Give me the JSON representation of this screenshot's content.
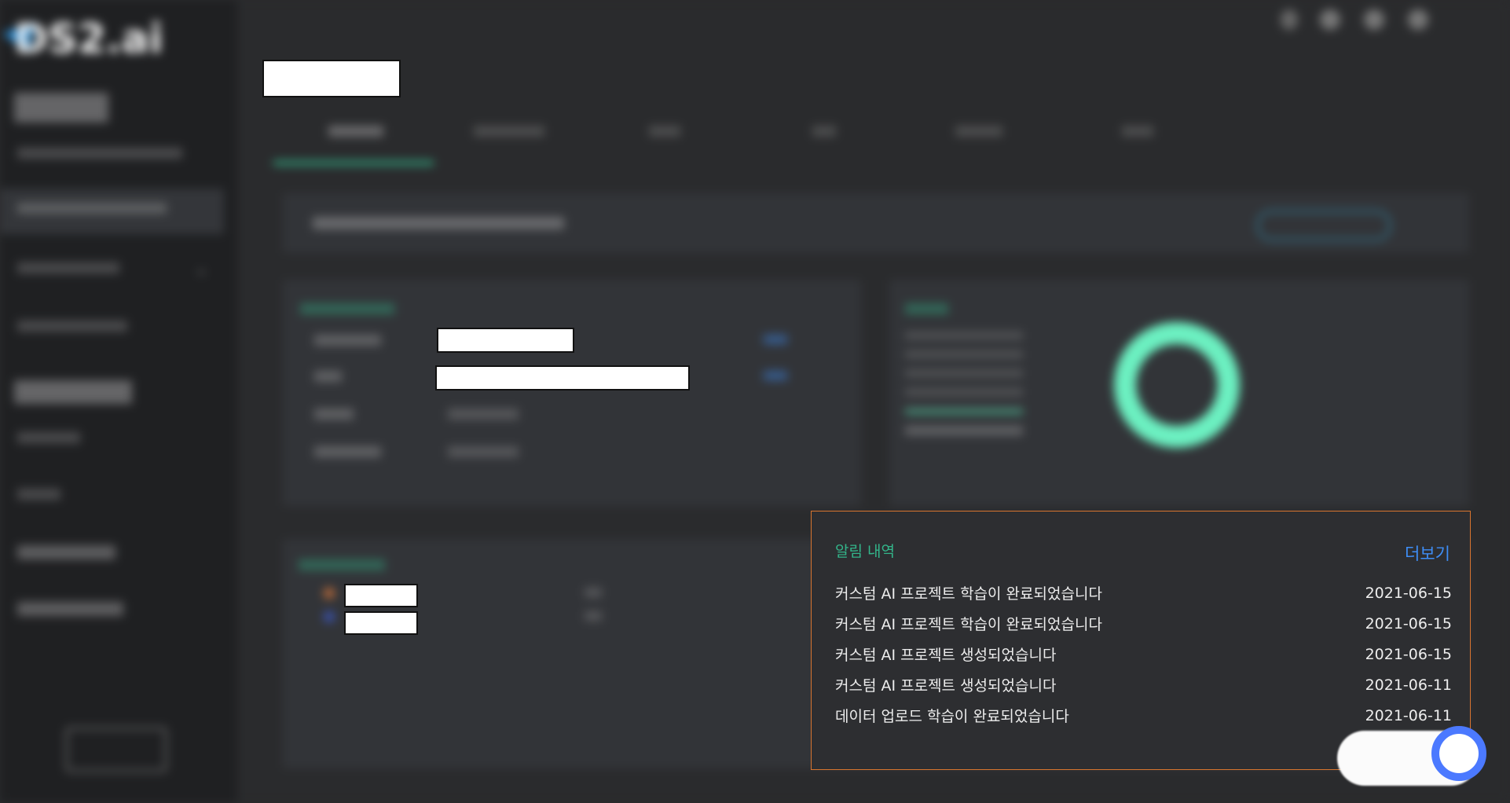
{
  "brand": {
    "logo_text": "DS2.ai"
  },
  "notification_panel": {
    "title": "알림 내역",
    "more_label": "더보기",
    "items": [
      {
        "message": "커스텀 AI 프로젝트 학습이 완료되었습니다",
        "date": "2021-06-15"
      },
      {
        "message": "커스텀 AI 프로젝트 학습이 완료되었습니다",
        "date": "2021-06-15"
      },
      {
        "message": "커스텀 AI 프로젝트 생성되었습니다",
        "date": "2021-06-15"
      },
      {
        "message": "커스텀 AI 프로젝트 생성되었습니다",
        "date": "2021-06-11"
      },
      {
        "message": "데이터 업로드 학습이 완료되었습니다",
        "date": "2021-06-11"
      }
    ]
  },
  "colors": {
    "accent_green": "#33b58a",
    "link_blue": "#3e8ef7",
    "panel_border": "#d9752f",
    "donut": "#6cf0c1"
  }
}
